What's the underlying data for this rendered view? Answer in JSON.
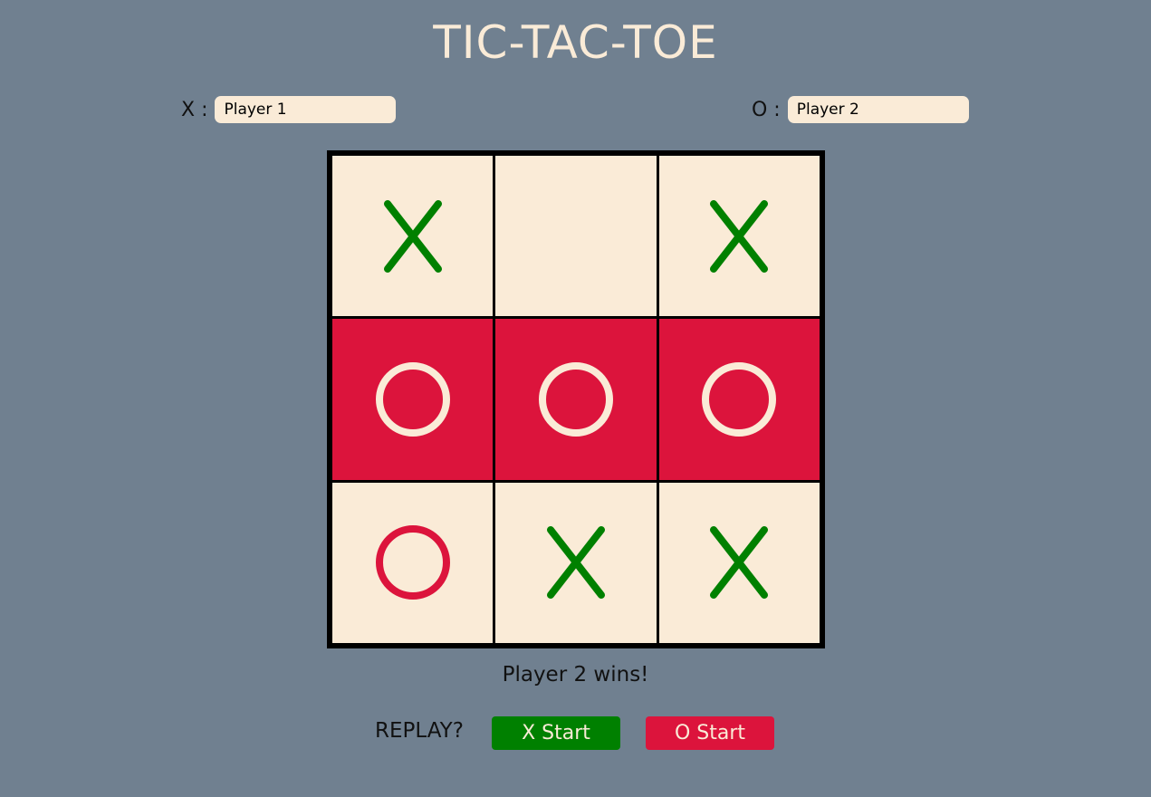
{
  "title": "TIC-TAC-TOE",
  "players": {
    "x": {
      "label": "X :",
      "value": "Player 1"
    },
    "o": {
      "label": "O :",
      "value": "Player 2"
    }
  },
  "board": {
    "cells": [
      "X",
      "",
      "X",
      "O",
      "O",
      "O",
      "O",
      "X",
      "X"
    ],
    "winning_cells": [
      3,
      4,
      5
    ]
  },
  "status": "Player 2 wins!",
  "replay": {
    "label": "REPLAY?",
    "x_start_label": "X Start",
    "o_start_label": "O Start"
  },
  "colors": {
    "background": "#708090",
    "cell": "#faebd7",
    "x_mark": "#008000",
    "o_mark": "#dc143c",
    "win_cell": "#dc143c",
    "win_mark": "#faebd7"
  }
}
